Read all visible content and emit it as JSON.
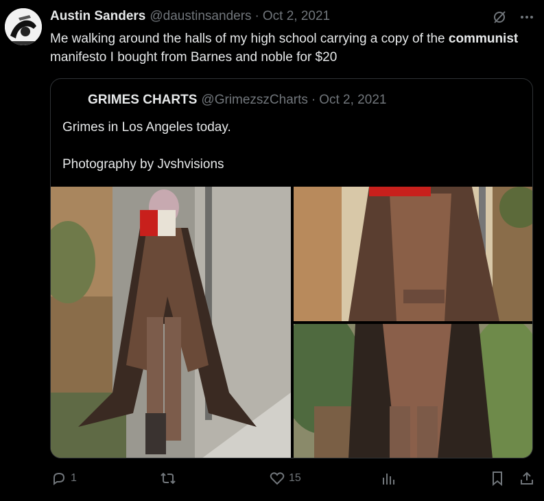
{
  "tweet": {
    "author_name": "Austin Sanders",
    "author_handle": "@daustinsanders",
    "separator": "·",
    "date": "Oct 2, 2021",
    "text_before": "Me walking around the halls of my high school carrying a copy of the ",
    "text_bold": "communist",
    "text_after": " manifesto I bought from Barnes and noble for $20"
  },
  "quote": {
    "author_name": "GRIMES CHARTS",
    "author_handle": "@GrimezszCharts",
    "separator": "·",
    "date": "Oct 2, 2021",
    "text": "Grimes in Los Angeles today.\n\nPhotography by Jvshvisions"
  },
  "actions": {
    "reply_count": "1",
    "repost_count": "",
    "like_count": "15"
  },
  "icons": [
    "grok-icon",
    "more-icon",
    "reply-icon",
    "repost-icon",
    "like-icon",
    "views-icon",
    "bookmark-icon",
    "share-icon"
  ],
  "colors": {
    "background": "#000000",
    "text": "#e7e9ea",
    "muted": "#71767b",
    "border": "#2f3336"
  }
}
